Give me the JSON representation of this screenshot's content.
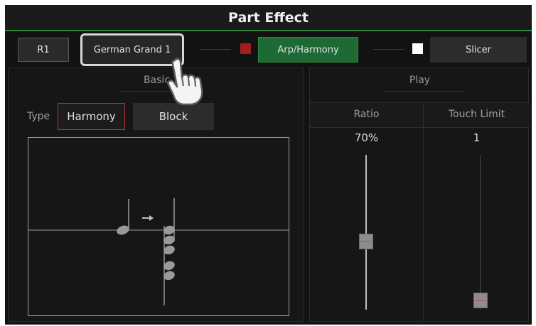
{
  "title": "Part Effect",
  "toolbar": {
    "part_label": "R1",
    "voice_label": "German Grand 1",
    "arp_label": "Arp/Harmony",
    "slicer_label": "Slicer",
    "arp_indicator_color": "#a01e1e",
    "slicer_indicator_color": "#ffffff",
    "active_color": "#1e6a35"
  },
  "basic": {
    "header": "Basic",
    "type_label": "Type",
    "type_value": "Harmony",
    "mode_value": "Block"
  },
  "play": {
    "header": "Play",
    "ratio_label": "Ratio",
    "ratio_value": "70%",
    "ratio_level": 0.7,
    "touch_label": "Touch Limit",
    "touch_value": "1",
    "touch_level": 0.01
  },
  "icons": {
    "notation": "harmony-block-notation-icon",
    "pointer": "pointing-hand-icon"
  }
}
